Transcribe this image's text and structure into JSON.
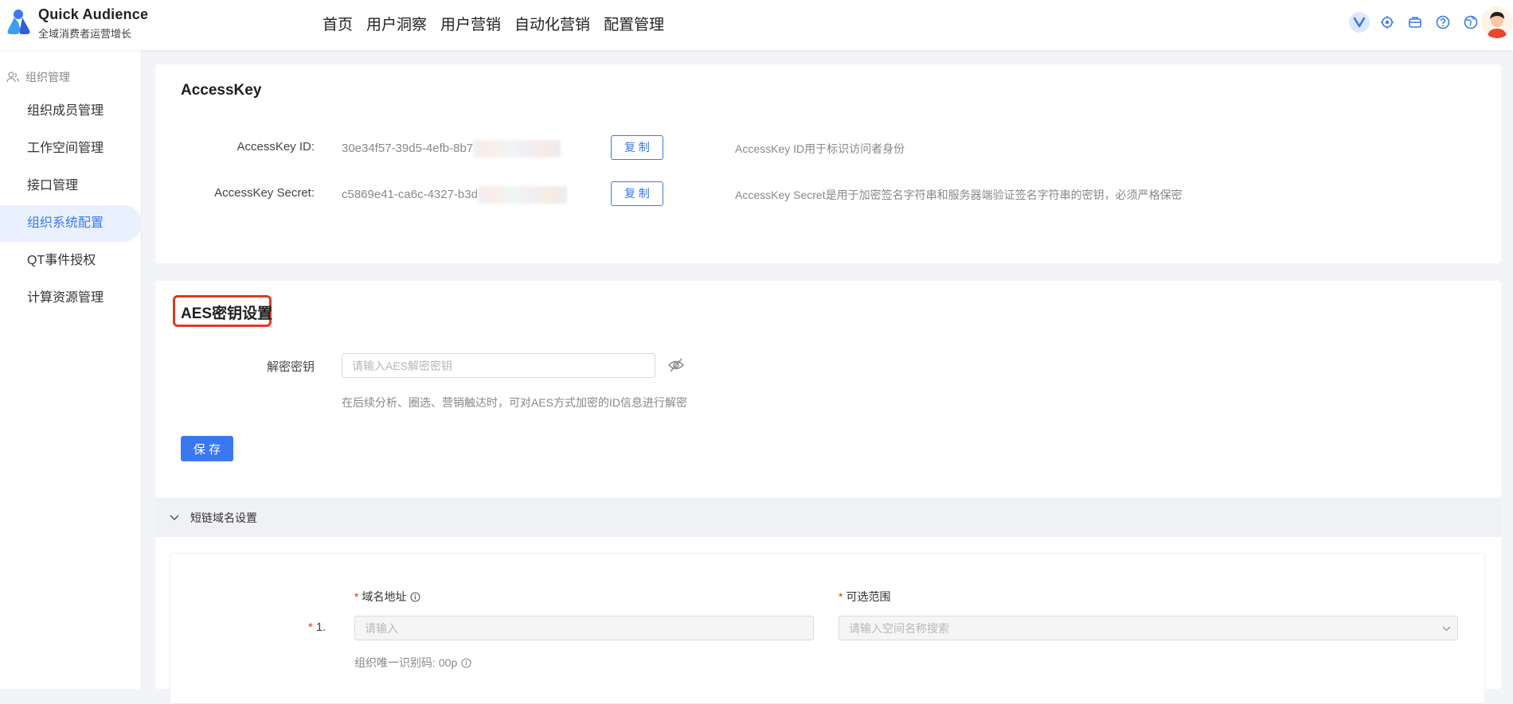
{
  "header": {
    "brand_title": "Quick Audience",
    "brand_subtitle": "全域消费者运营增长",
    "nav": [
      "首页",
      "用户洞察",
      "用户营销",
      "自动化营销",
      "配置管理"
    ],
    "icons": [
      "v-badge-icon",
      "settings-cog-icon",
      "briefcase-icon",
      "help-icon",
      "globe-icon"
    ]
  },
  "sidebar": {
    "group_label": "组织管理",
    "items": [
      "组织成员管理",
      "工作空间管理",
      "接口管理",
      "组织系统配置",
      "QT事件授权",
      "计算资源管理"
    ],
    "active_index": 3
  },
  "accesskey": {
    "title": "AccessKey",
    "id_label": "AccessKey ID:",
    "id_value": "30e34f57-39d5-4efb-8b7",
    "secret_label": "AccessKey Secret:",
    "secret_value": "c5869e41-ca6c-4327-b3d",
    "copy_label": "复 制",
    "id_desc": "AccessKey ID用于标识访问者身份",
    "secret_desc": "AccessKey Secret是用于加密签名字符串和服务器端验证签名字符串的密钥，必须严格保密"
  },
  "aes": {
    "title": "AES密钥设置",
    "key_label": "解密密钥",
    "key_placeholder": "请输入AES解密密钥",
    "help": "在后续分析、圈选、营销触达时，可对AES方式加密的ID信息进行解密",
    "save_label": "保 存"
  },
  "short_link": {
    "section_title": "短链域名设置",
    "domain_label": "域名地址",
    "scope_label": "可选范围",
    "row_index": "1.",
    "domain_placeholder": "请输入",
    "scope_placeholder": "请输入空间名称搜索",
    "org_code_label": "组织唯一识别码:",
    "org_code_value": "00p"
  },
  "colors": {
    "accent": "#3a78f2",
    "required": "#e0361f",
    "highlight_box": "#e13a1f"
  }
}
